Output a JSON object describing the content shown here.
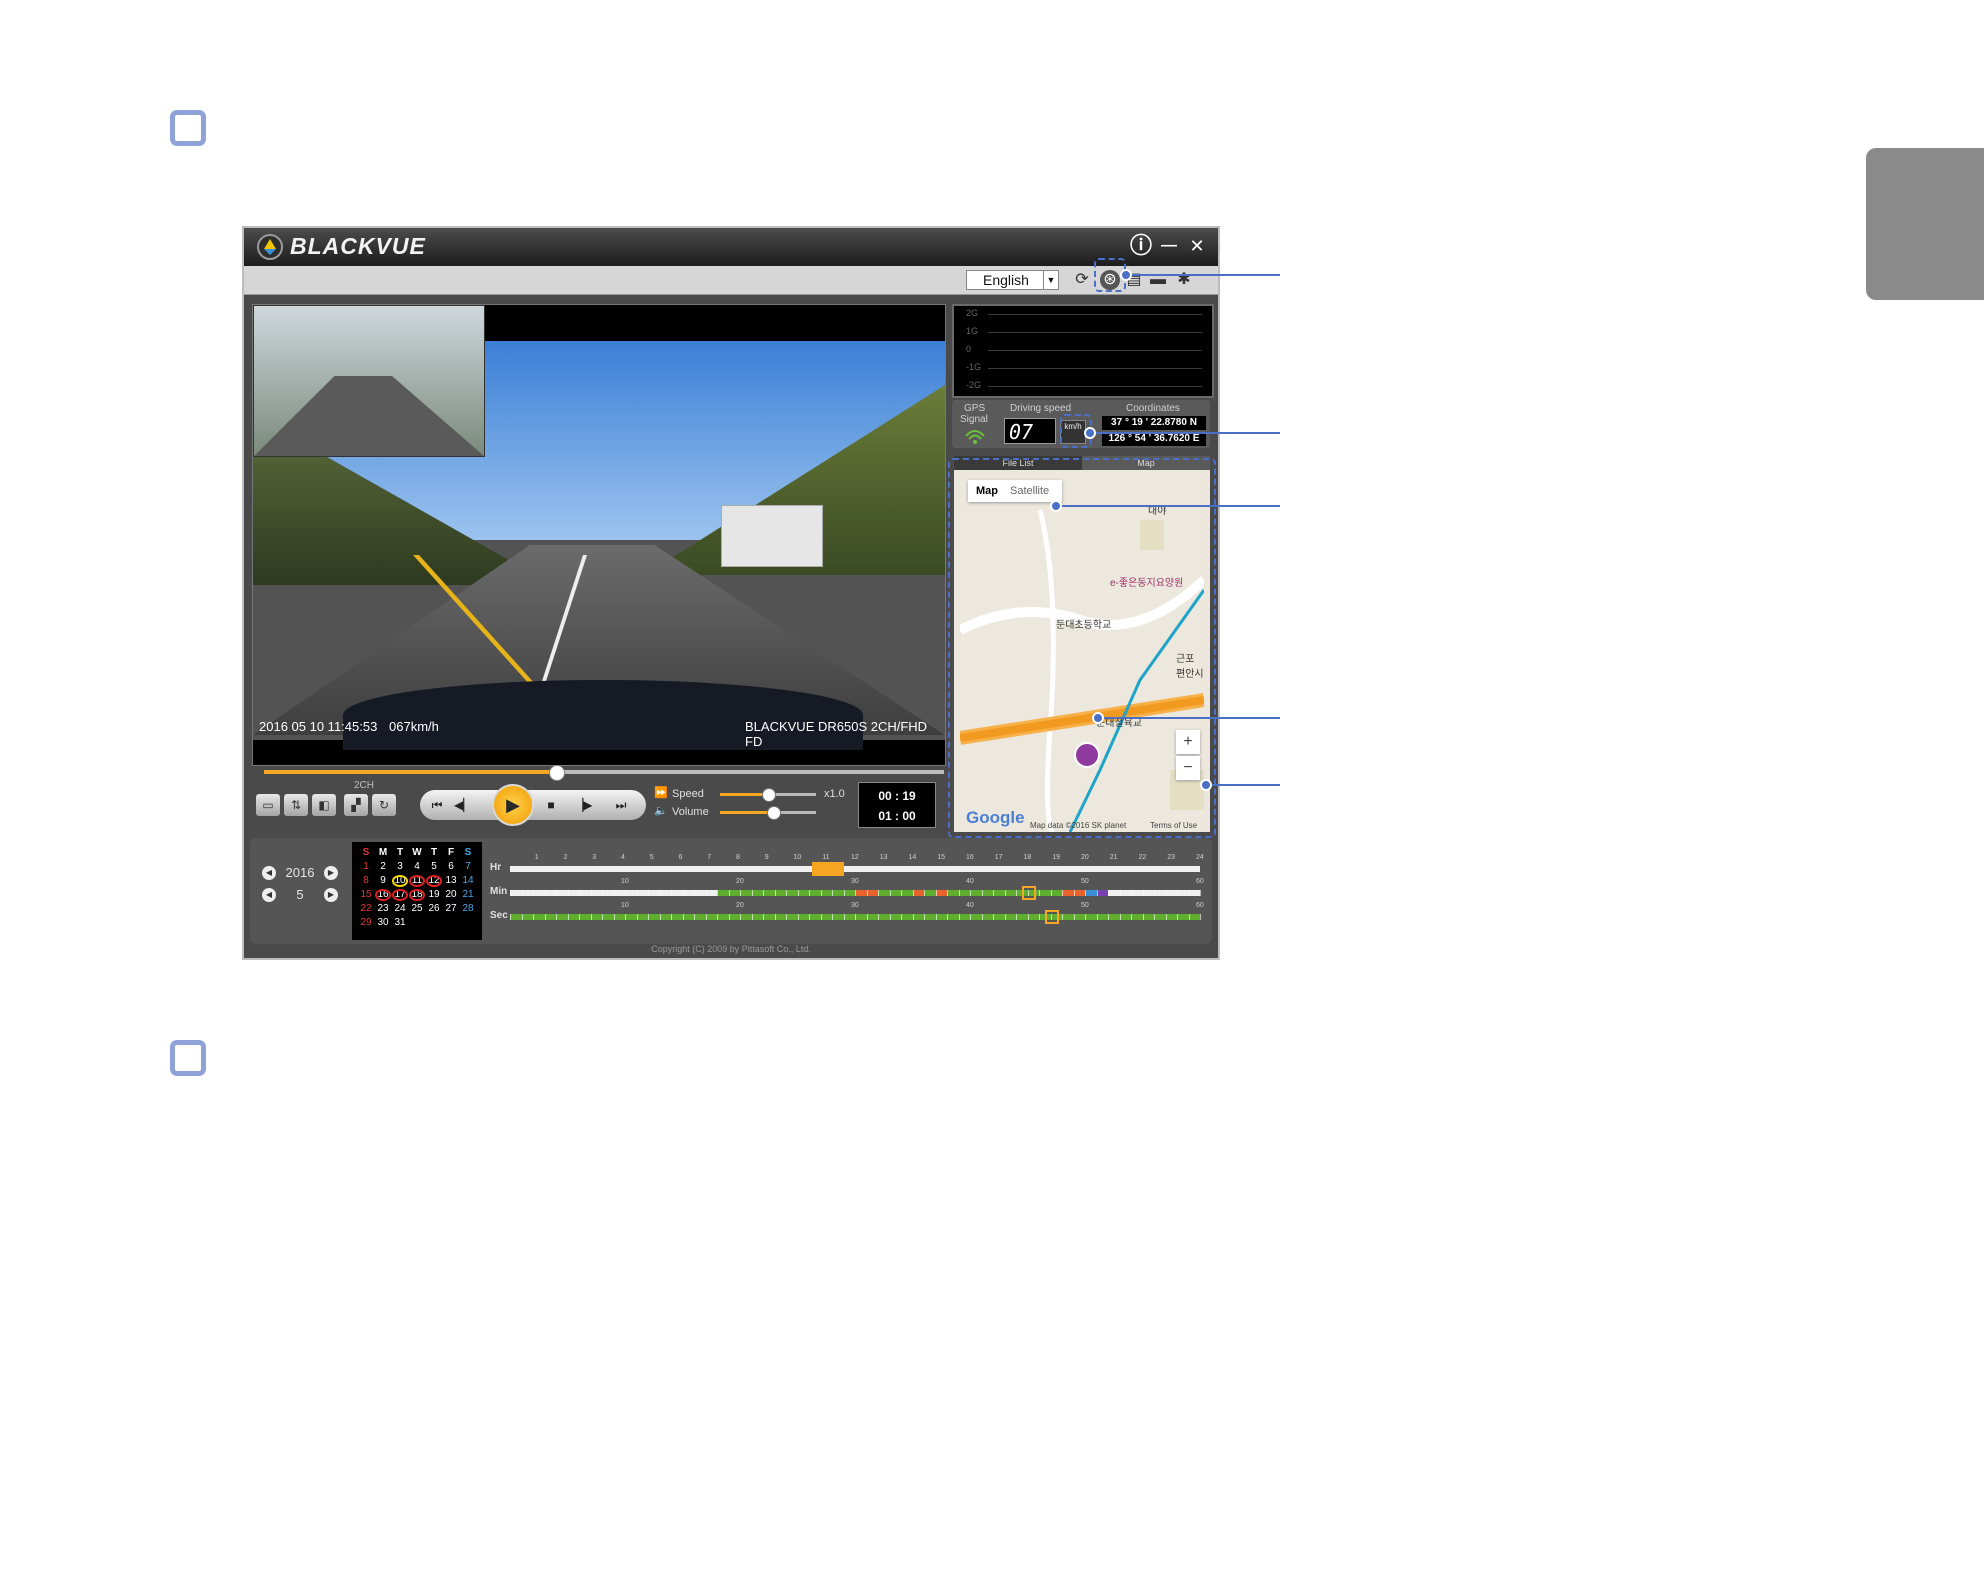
{
  "page": {
    "background": "#ffffff",
    "accent": "#4a6fc7",
    "bullet_color": "#8fa3d8"
  },
  "app": {
    "brand": "BLACKVUE",
    "window_buttons": {
      "info": "ⓘ",
      "minimize": "—",
      "close": "✕"
    },
    "toolbar": {
      "language": "English"
    },
    "video": {
      "timestamp": "2016 05 10 11:45:53",
      "speed": "067km/h",
      "model": "BLACKVUE DR650S 2CH/FHD FD"
    },
    "playback": {
      "progress": 0.43,
      "channel_label": "2CH",
      "speed_label": "Speed",
      "speed_value": "x1.0",
      "speed_level": 0.5,
      "volume_label": "Volume",
      "volume_level": 0.55,
      "current_time": "00 : 19",
      "total_time": "01 : 00"
    },
    "gsensor": {
      "labels": [
        "2G",
        "1G",
        "0",
        "-1G",
        "-2G"
      ]
    },
    "gps": {
      "signal_label_1": "GPS",
      "signal_label_2": "Signal",
      "driving_speed_label": "Driving speed",
      "speed_digits": "07",
      "unit": "km/h",
      "coordinates_label": "Coordinates",
      "lat": "37 ° 19 ' 22.8780 N",
      "lon": "126 ° 54 ' 36.7620 E"
    },
    "map": {
      "tabs": [
        "File List",
        "Map"
      ],
      "map_type": [
        "Map",
        "Satellite"
      ],
      "labels": [
        "대야",
        "e-좋은동지요양원",
        "둔대초등학교",
        "둔대철육교",
        "근포\n편안시"
      ],
      "google": "Google",
      "attribution": "Map data ©2016 SK planet",
      "terms": "Terms of Use",
      "zoom_in": "+",
      "zoom_out": "−"
    },
    "calendar": {
      "year": "2016",
      "month": "5",
      "weekdays": [
        "S",
        "M",
        "T",
        "W",
        "T",
        "F",
        "S"
      ],
      "weeks": [
        [
          "1",
          "2",
          "3",
          "4",
          "5",
          "6",
          "7"
        ],
        [
          "8",
          "9",
          "10",
          "11",
          "12",
          "13",
          "14"
        ],
        [
          "15",
          "16",
          "17",
          "18",
          "19",
          "20",
          "21"
        ],
        [
          "22",
          "23",
          "24",
          "25",
          "26",
          "27",
          "28"
        ],
        [
          "29",
          "30",
          "31",
          "",
          "",
          "",
          ""
        ]
      ],
      "recorded_days": [
        "10",
        "11",
        "12",
        "16",
        "17",
        "18"
      ],
      "selected_day": "10"
    },
    "timeline": {
      "hr_label": "Hr",
      "min_label": "Min",
      "sec_label": "Sec",
      "hours": [
        "1",
        "2",
        "3",
        "4",
        "5",
        "6",
        "7",
        "8",
        "9",
        "10",
        "11",
        "12",
        "13",
        "14",
        "15",
        "16",
        "17",
        "18",
        "19",
        "20",
        "21",
        "22",
        "23",
        "24"
      ],
      "min_ticks": [
        "10",
        "20",
        "30",
        "40",
        "50",
        "60"
      ],
      "sec_ticks": [
        "10",
        "20",
        "30",
        "40",
        "50",
        "60"
      ],
      "selected_hour": 11,
      "selected_minute": 45,
      "selected_second": 47
    },
    "copyright": "Copyright (C) 2009 by Pittasoft Co., Ltd.",
    "colors": {
      "normal": "#5fae2e",
      "event": "#e8622c",
      "selected": "#f5a623",
      "parking": "#3a8fd6",
      "manual": "#7a3fb0"
    }
  }
}
